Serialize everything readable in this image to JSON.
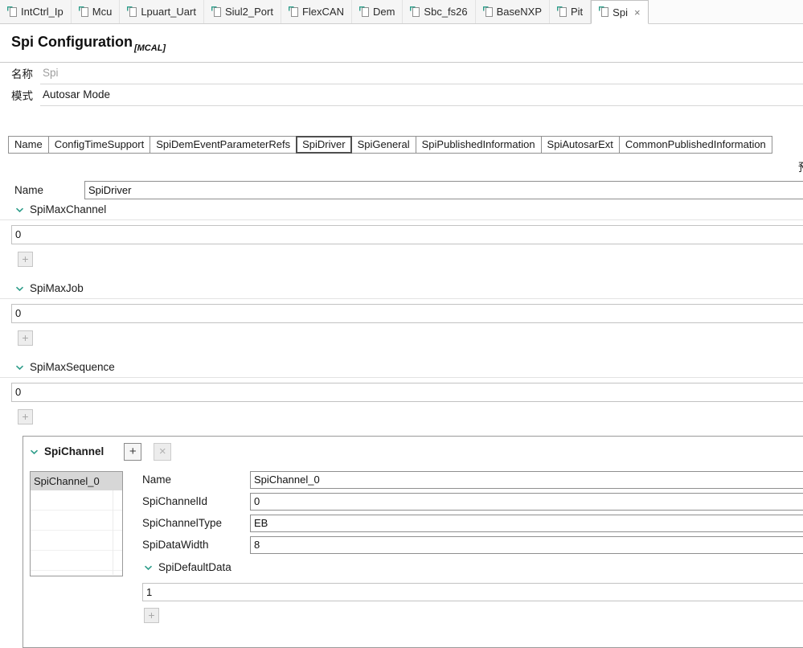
{
  "symbols": {
    "add": "+",
    "remove": "×"
  },
  "editor_tabs": {
    "close_symbol": "×",
    "tabs": [
      {
        "label": "IntCtrl_Ip",
        "active": false
      },
      {
        "label": "Mcu",
        "active": false
      },
      {
        "label": "Lpuart_Uart",
        "active": false
      },
      {
        "label": "Siul2_Port",
        "active": false
      },
      {
        "label": "FlexCAN",
        "active": false
      },
      {
        "label": "Dem",
        "active": false
      },
      {
        "label": "Sbc_fs26",
        "active": false
      },
      {
        "label": "BaseNXP",
        "active": false
      },
      {
        "label": "Pit",
        "active": false
      },
      {
        "label": "Spi",
        "active": true
      }
    ]
  },
  "header": {
    "title": "Spi Configuration",
    "tag": "[MCAL]"
  },
  "top_form": {
    "name_label": "名称",
    "name_value": "Spi",
    "mode_label": "模式",
    "mode_value": "Autosar Mode"
  },
  "config_tabs": {
    "tabs": [
      {
        "label": "Name",
        "active": false
      },
      {
        "label": "ConfigTimeSupport",
        "active": false
      },
      {
        "label": "SpiDemEventParameterRefs",
        "active": false
      },
      {
        "label": "SpiDriver",
        "active": true
      },
      {
        "label": "SpiGeneral",
        "active": false
      },
      {
        "label": "SpiPublishedInformation",
        "active": false
      },
      {
        "label": "SpiAutosarExt",
        "active": false
      },
      {
        "label": "CommonPublishedInformation",
        "active": false
      }
    ],
    "clipped_text": "预"
  },
  "driver": {
    "name_label": "Name",
    "name_value": "SpiDriver",
    "sections": [
      {
        "label": "SpiMaxChannel",
        "value": "0"
      },
      {
        "label": "SpiMaxJob",
        "value": "0"
      },
      {
        "label": "SpiMaxSequence",
        "value": "0"
      }
    ]
  },
  "spi_channel": {
    "title": "SpiChannel",
    "list_items": [
      "SpiChannel_0"
    ],
    "fields": [
      {
        "label": "Name",
        "value": "SpiChannel_0"
      },
      {
        "label": "SpiChannelId",
        "value": "0"
      },
      {
        "label": "SpiChannelType",
        "value": "EB"
      },
      {
        "label": "SpiDataWidth",
        "value": "8"
      }
    ],
    "default_data": {
      "label": "SpiDefaultData",
      "value": "1"
    }
  }
}
